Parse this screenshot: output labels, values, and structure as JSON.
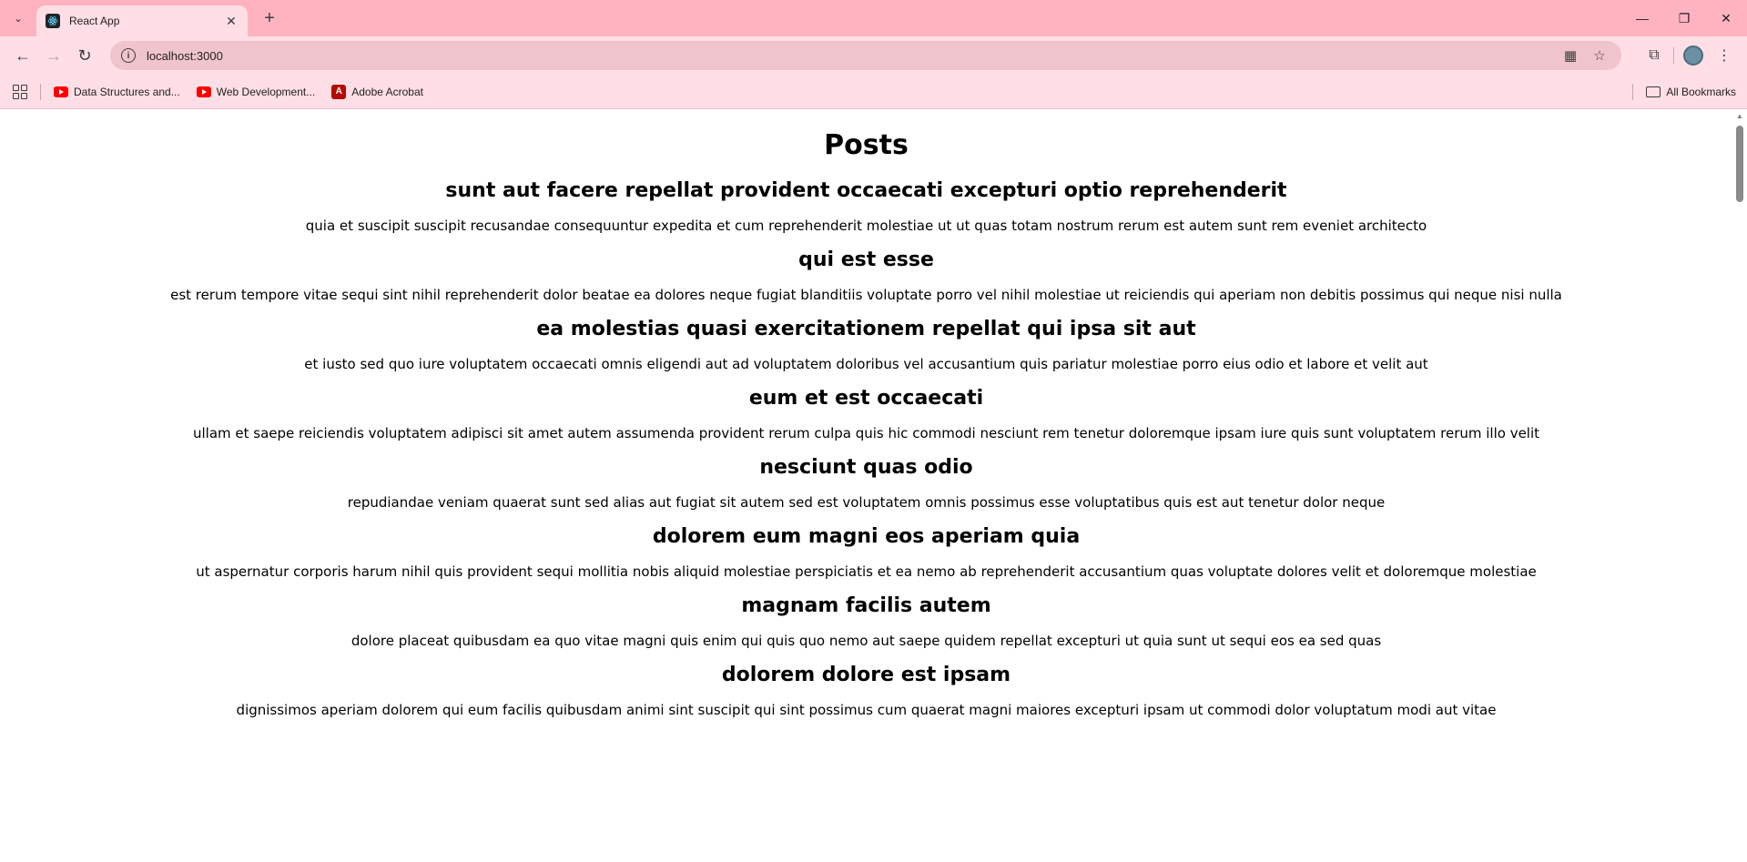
{
  "browser": {
    "tab_title": "React App",
    "url": "localhost:3000",
    "bookmarks": [
      {
        "label": "Data Structures and...",
        "icon": "youtube-icon"
      },
      {
        "label": "Web Development...",
        "icon": "youtube-icon"
      },
      {
        "label": "Adobe Acrobat",
        "icon": "acrobat-icon"
      }
    ],
    "all_bookmarks_label": "All Bookmarks"
  },
  "page": {
    "heading": "Posts",
    "posts": [
      {
        "title": "sunt aut facere repellat provident occaecati excepturi optio reprehenderit",
        "body": "quia et suscipit suscipit recusandae consequuntur expedita et cum reprehenderit molestiae ut ut quas totam nostrum rerum est autem sunt rem eveniet architecto"
      },
      {
        "title": "qui est esse",
        "body": "est rerum tempore vitae sequi sint nihil reprehenderit dolor beatae ea dolores neque fugiat blanditiis voluptate porro vel nihil molestiae ut reiciendis qui aperiam non debitis possimus qui neque nisi nulla"
      },
      {
        "title": "ea molestias quasi exercitationem repellat qui ipsa sit aut",
        "body": "et iusto sed quo iure voluptatem occaecati omnis eligendi aut ad voluptatem doloribus vel accusantium quis pariatur molestiae porro eius odio et labore et velit aut"
      },
      {
        "title": "eum et est occaecati",
        "body": "ullam et saepe reiciendis voluptatem adipisci sit amet autem assumenda provident rerum culpa quis hic commodi nesciunt rem tenetur doloremque ipsam iure quis sunt voluptatem rerum illo velit"
      },
      {
        "title": "nesciunt quas odio",
        "body": "repudiandae veniam quaerat sunt sed alias aut fugiat sit autem sed est voluptatem omnis possimus esse voluptatibus quis est aut tenetur dolor neque"
      },
      {
        "title": "dolorem eum magni eos aperiam quia",
        "body": "ut aspernatur corporis harum nihil quis provident sequi mollitia nobis aliquid molestiae perspiciatis et ea nemo ab reprehenderit accusantium quas voluptate dolores velit et doloremque molestiae"
      },
      {
        "title": "magnam facilis autem",
        "body": "dolore placeat quibusdam ea quo vitae magni quis enim qui quis quo nemo aut saepe quidem repellat excepturi ut quia sunt ut sequi eos ea sed quas"
      },
      {
        "title": "dolorem dolore est ipsam",
        "body": "dignissimos aperiam dolorem qui eum facilis quibusdam animi sint suscipit qui sint possimus cum quaerat magni maiores excepturi ipsam ut commodi dolor voluptatum modi aut vitae"
      }
    ]
  }
}
